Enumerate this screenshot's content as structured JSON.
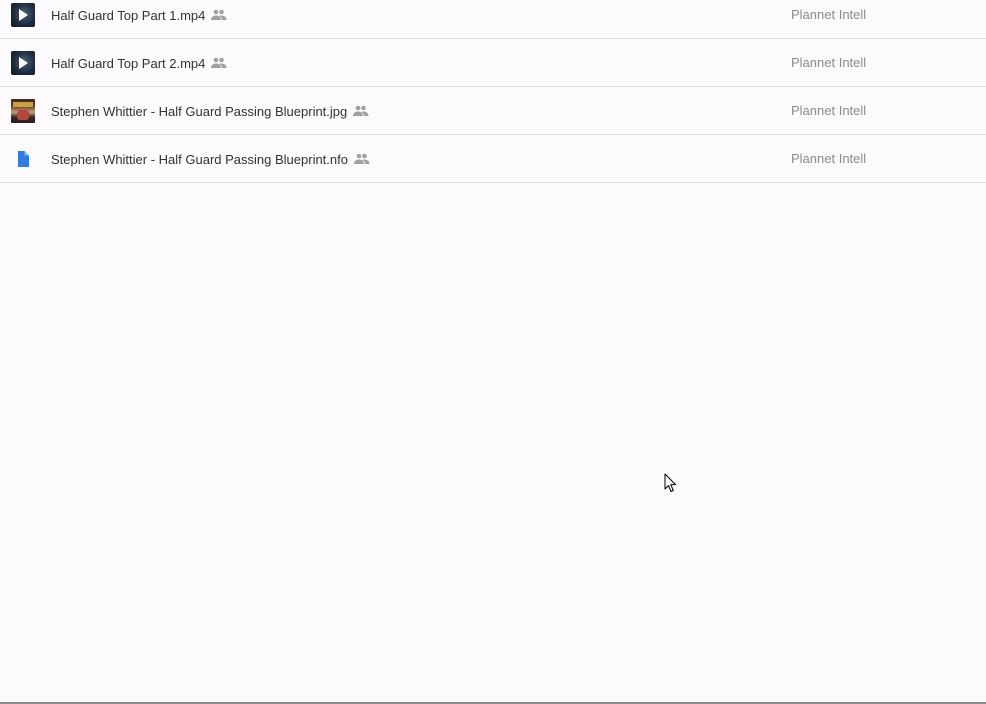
{
  "files": [
    {
      "name": "Half Guard Top Part 1.mp4",
      "type": "video",
      "icon": "video-play-icon",
      "shared_icon": "people-icon",
      "owner": "Plannet Intell"
    },
    {
      "name": "Half Guard Top Part 2.mp4",
      "type": "video",
      "icon": "video-play-icon",
      "shared_icon": "people-icon",
      "owner": "Plannet Intell"
    },
    {
      "name": "Stephen Whittier - Half Guard Passing Blueprint.jpg",
      "type": "image",
      "icon": "image-thumbnail-icon",
      "shared_icon": "people-icon",
      "owner": "Plannet Intell"
    },
    {
      "name": "Stephen Whittier - Half Guard Passing Blueprint.nfo",
      "type": "document",
      "icon": "document-icon",
      "shared_icon": "people-icon",
      "owner": "Plannet Intell"
    }
  ],
  "colors": {
    "background": "#fcfafd",
    "row_divider": "#dcdcdc",
    "file_name_text": "#333333",
    "owner_text": "#8a8a8a",
    "shared_icon": "#a0a0a0",
    "document_icon": "#2f7de1"
  }
}
